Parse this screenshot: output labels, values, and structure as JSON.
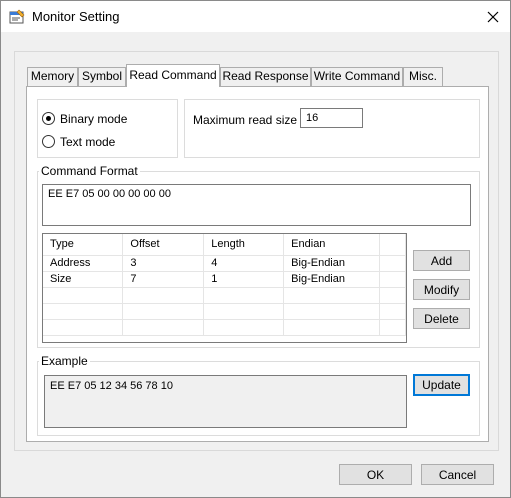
{
  "window": {
    "title": "Monitor Setting"
  },
  "tabs": [
    {
      "label": "Memory"
    },
    {
      "label": "Symbol"
    },
    {
      "label": "Read Command"
    },
    {
      "label": "Read Response"
    },
    {
      "label": "Write Command"
    },
    {
      "label": "Misc."
    }
  ],
  "active_tab": "Read Command",
  "mode": {
    "options": [
      {
        "label": "Binary mode",
        "selected": true
      },
      {
        "label": "Text mode",
        "selected": false
      }
    ]
  },
  "max_read": {
    "label": "Maximum read size",
    "value": "16"
  },
  "command_format": {
    "group_label": "Command Format",
    "value": "EE E7 05 00 00 00 00 00",
    "columns": [
      "Type",
      "Offset",
      "Length",
      "Endian"
    ],
    "rows": [
      [
        "Address",
        "3",
        "4",
        "Big-Endian"
      ],
      [
        "Size",
        "7",
        "1",
        "Big-Endian"
      ]
    ],
    "buttons": {
      "add": "Add",
      "modify": "Modify",
      "delete": "Delete"
    }
  },
  "example": {
    "group_label": "Example",
    "value": "EE E7 05 12 34 56 78 10",
    "update_label": "Update"
  },
  "footer": {
    "ok_label": "OK",
    "cancel_label": "Cancel"
  },
  "colors": {
    "accent": "#0078d7",
    "panel": "#f0f0f0",
    "content": "#ffffff"
  }
}
